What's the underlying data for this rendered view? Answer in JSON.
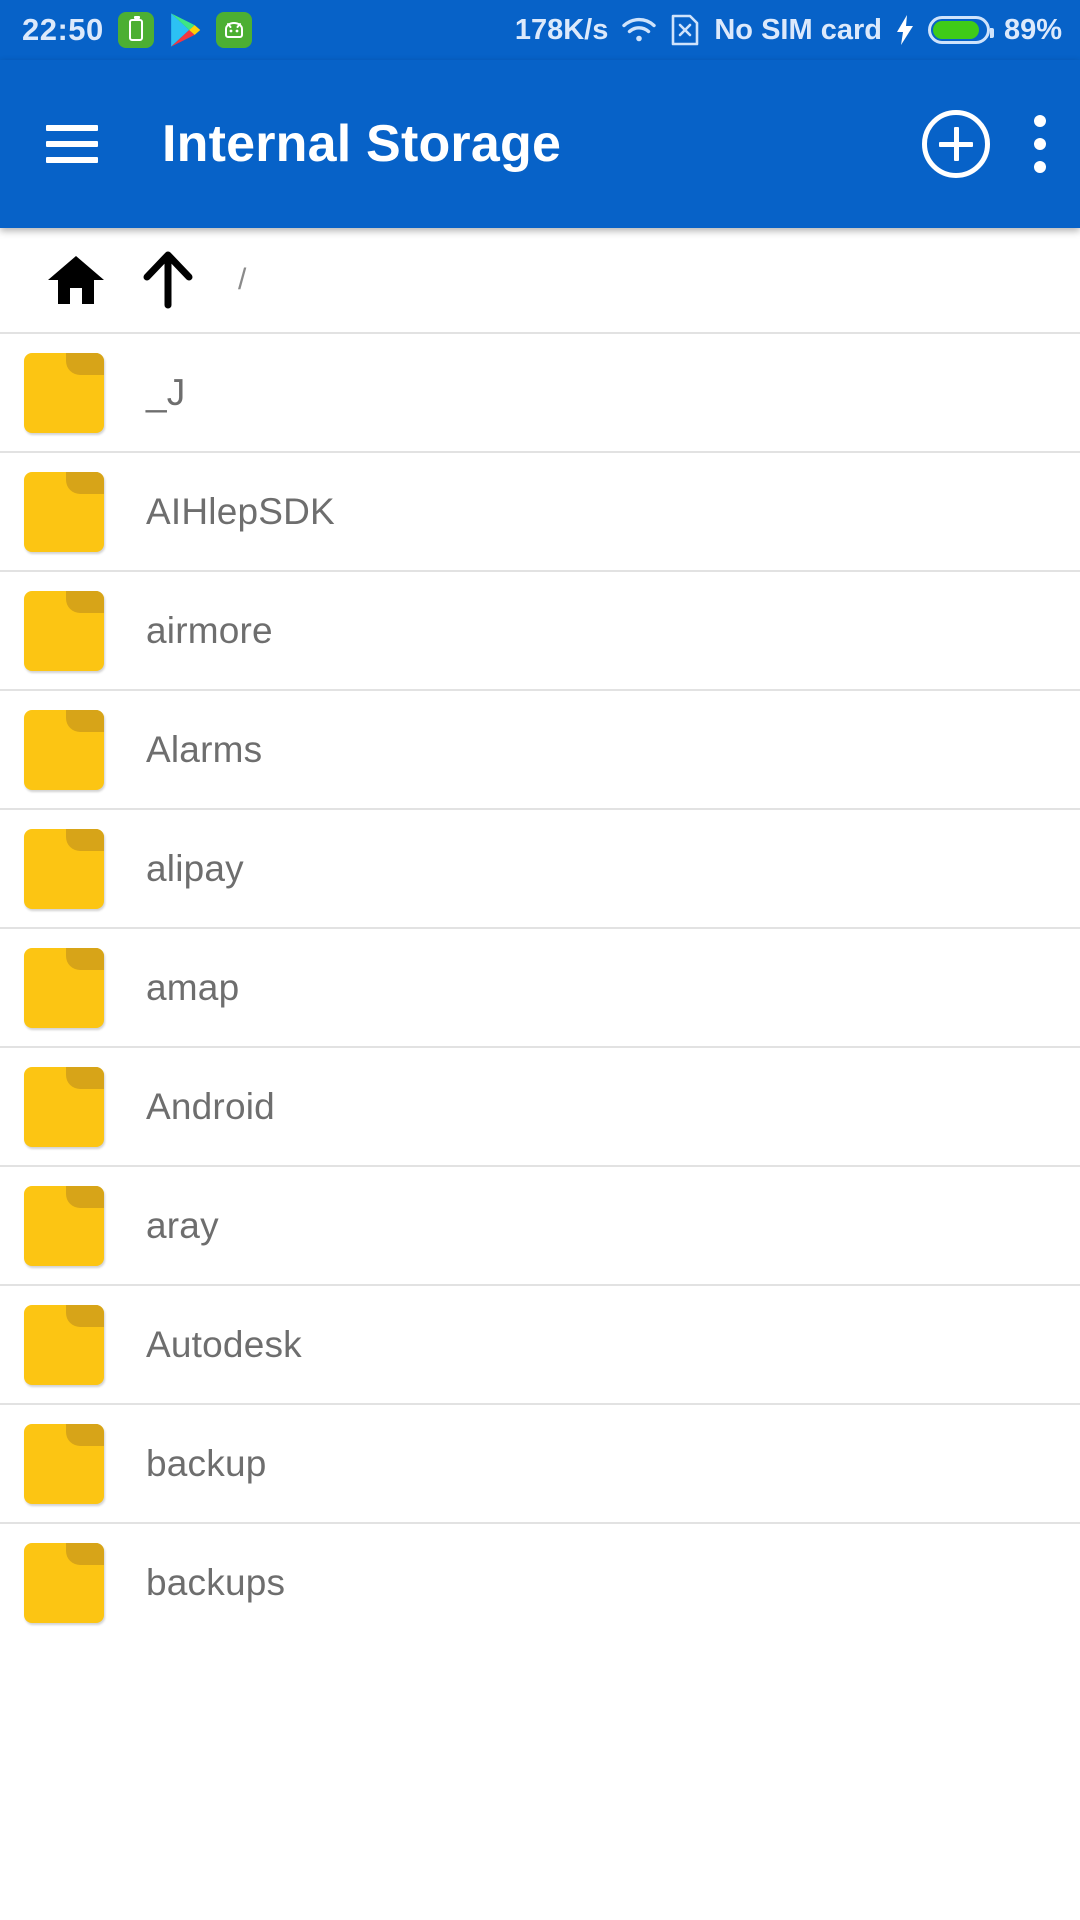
{
  "status_bar": {
    "time": "22:50",
    "network_speed": "178K/s",
    "sim_status": "No SIM card",
    "battery_percent": "89%",
    "battery_level": 89,
    "icons": {
      "battery_app": "battery-app-icon",
      "play_store": "play-store-icon",
      "robot": "android-robot-icon",
      "wifi": "wifi-icon",
      "sim": "sim-card-x-icon",
      "charging": "charging-bolt-icon",
      "battery": "battery-icon"
    },
    "colors": {
      "bar_background": "#0762C8",
      "text": "#dce9fb",
      "battery_fill": "#3FCB18",
      "app_badge_green": "#4CAF32"
    }
  },
  "app_bar": {
    "title": "Internal Storage",
    "menu_icon": "hamburger-menu-icon",
    "add_icon": "add-circle-icon",
    "overflow_icon": "overflow-menu-icon",
    "background": "#0762C8"
  },
  "breadcrumb": {
    "home_icon": "home-icon",
    "up_icon": "arrow-up-icon",
    "path": "/"
  },
  "file_list": {
    "folder_color": "#FCC513",
    "folder_tab_color": "#D7A418",
    "divider_color": "#e2e2e2",
    "items": [
      {
        "name": "_J",
        "type": "folder"
      },
      {
        "name": "AIHlepSDK",
        "type": "folder"
      },
      {
        "name": "airmore",
        "type": "folder"
      },
      {
        "name": "Alarms",
        "type": "folder"
      },
      {
        "name": "alipay",
        "type": "folder"
      },
      {
        "name": "amap",
        "type": "folder"
      },
      {
        "name": "Android",
        "type": "folder"
      },
      {
        "name": "aray",
        "type": "folder"
      },
      {
        "name": "Autodesk",
        "type": "folder"
      },
      {
        "name": "backup",
        "type": "folder"
      },
      {
        "name": "backups",
        "type": "folder"
      }
    ]
  }
}
